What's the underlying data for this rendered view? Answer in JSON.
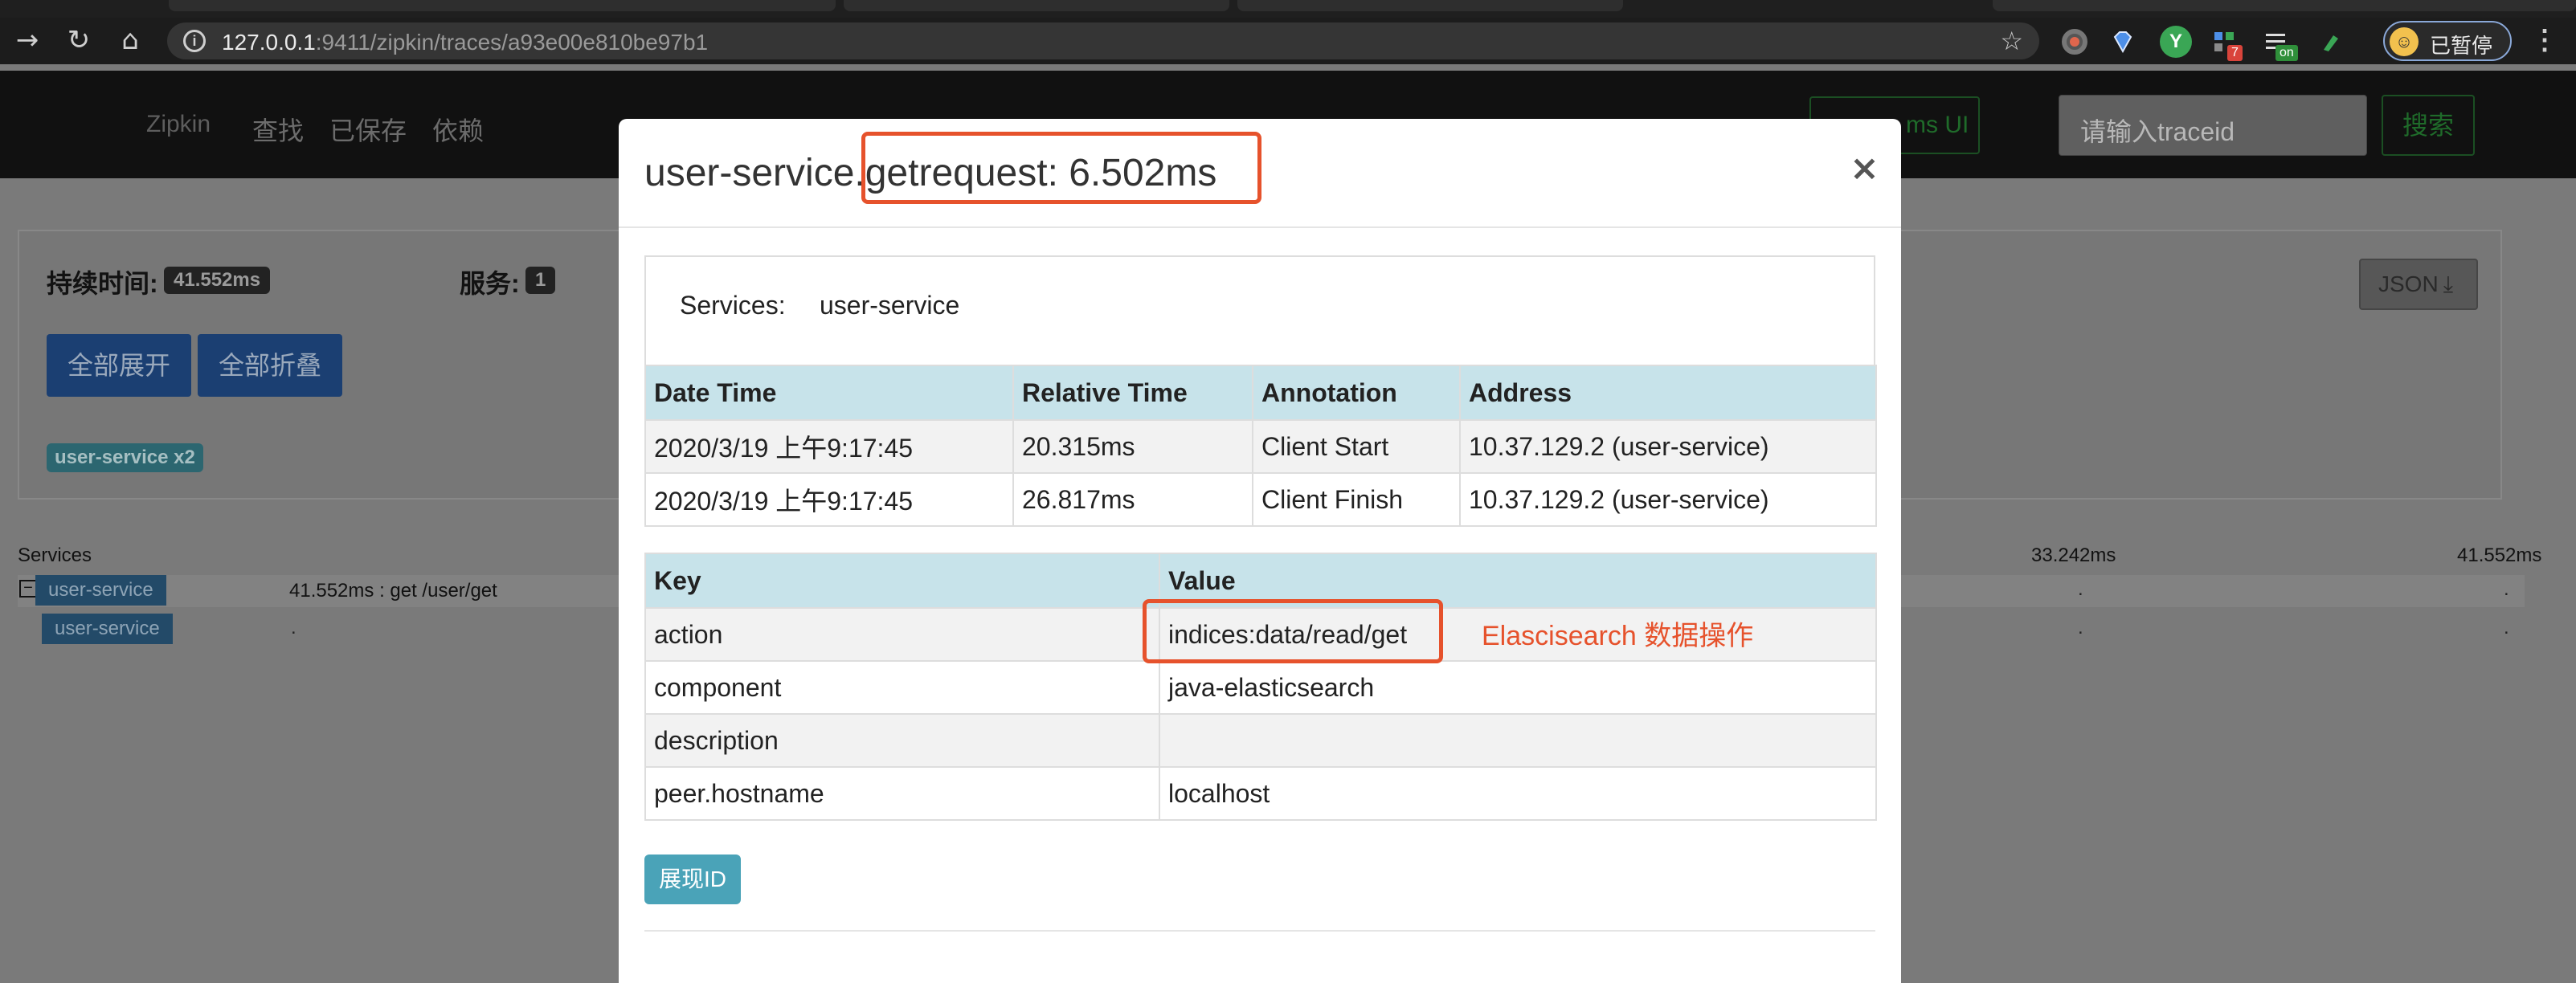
{
  "browser": {
    "url_host": "127.0.0.1",
    "url_rest": ":9411/zipkin/traces/a93e00e810be97b1",
    "ext_badge_1": "7",
    "ext_badge_2": "on",
    "profile_label": "已暂停"
  },
  "zipkin_nav": {
    "brand": "Zipkin",
    "links": [
      "查找",
      "已保存",
      "依赖"
    ],
    "lens_button": "ms UI",
    "search_placeholder": "请输入traceid",
    "search_button": "搜索"
  },
  "trace_summary": {
    "duration_label": "持续时间:",
    "duration_value": "41.552ms",
    "services_label": "服务:",
    "services_value": "1",
    "expand_all": "全部展开",
    "collapse_all": "全部折叠",
    "service_badge": "user-service x2",
    "json_button": "JSON"
  },
  "timeline": {
    "services_header": "Services",
    "ticks": [
      "33.242ms",
      "41.552ms"
    ],
    "rows": [
      {
        "service": "user-service",
        "label": "41.552ms : get /user/get"
      },
      {
        "service": "user-service",
        "label": "."
      }
    ]
  },
  "modal": {
    "title": "user-service.getrequest: 6.502ms",
    "close": "×",
    "services_label": "Services:",
    "services_value": "user-service",
    "annotations_headers": [
      "Date Time",
      "Relative Time",
      "Annotation",
      "Address"
    ],
    "annotations": [
      [
        "2020/3/19 上午9:17:45",
        "20.315ms",
        "Client Start",
        "10.37.129.2 (user-service)"
      ],
      [
        "2020/3/19 上午9:17:45",
        "26.817ms",
        "Client Finish",
        "10.37.129.2 (user-service)"
      ]
    ],
    "tags_headers": [
      "Key",
      "Value"
    ],
    "tags": [
      [
        "action",
        "indices:data/read/get"
      ],
      [
        "component",
        "java-elasticsearch"
      ],
      [
        "description",
        ""
      ],
      [
        "peer.hostname",
        "localhost"
      ]
    ],
    "annotation_note": "Elascisearch 数据操作",
    "show_id_button": "展现ID"
  },
  "colors": {
    "highlight": "#e6522c",
    "table_header": "#c7e3ea",
    "show_id_button": "#4aa3b8"
  }
}
